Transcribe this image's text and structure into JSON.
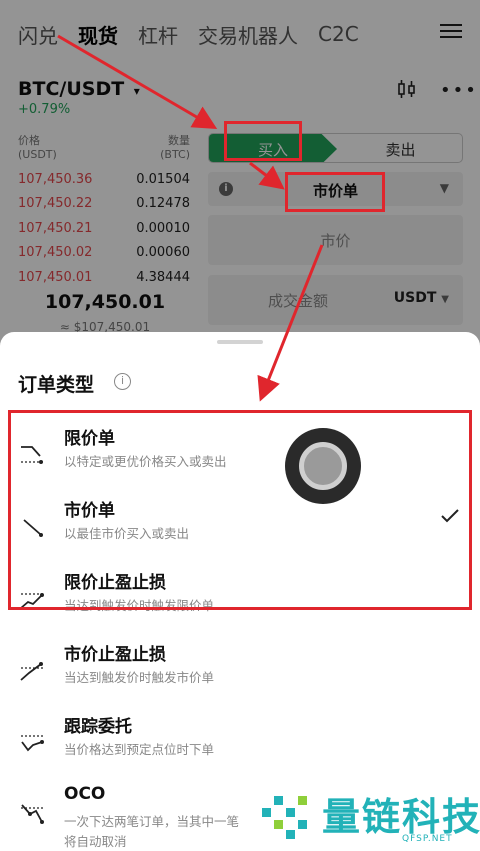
{
  "tabs": [
    "闪兑",
    "现货",
    "杠杆",
    "交易机器人",
    "C2C"
  ],
  "active_tab": "现货",
  "pair": {
    "symbol": "BTC/USDT",
    "change": "+0.79%"
  },
  "orderbook": {
    "price_header": "价格",
    "price_unit": "(USDT)",
    "qty_header": "数量",
    "qty_unit": "(BTC)",
    "asks": [
      {
        "price": "107,450.36",
        "qty": "0.01504"
      },
      {
        "price": "107,450.22",
        "qty": "0.12478"
      },
      {
        "price": "107,450.21",
        "qty": "0.00010"
      },
      {
        "price": "107,450.02",
        "qty": "0.00060"
      },
      {
        "price": "107,450.01",
        "qty": "4.38444"
      }
    ],
    "last_price": "107,450.01",
    "last_price_fiat": "≈ $107,450.01"
  },
  "trade_form": {
    "buy_label": "买入",
    "sell_label": "卖出",
    "order_type": "市价单",
    "price_placeholder": "市价",
    "amount_label": "成交金额",
    "amount_unit": "USDT"
  },
  "sheet": {
    "title": "订单类型",
    "options": [
      {
        "name": "限价单",
        "desc": "以特定或更优价格买入或卖出",
        "selected": false
      },
      {
        "name": "市价单",
        "desc": "以最佳市价买入或卖出",
        "selected": true
      },
      {
        "name": "限价止盈止损",
        "desc": "当达到触发价时触发限价单",
        "selected": false
      },
      {
        "name": "市价止盈止损",
        "desc": "当达到触发价时触发市价单",
        "selected": false
      },
      {
        "name": "跟踪委托",
        "desc": "当价格达到预定点位时下单",
        "selected": false
      },
      {
        "name": "OCO",
        "desc": "一次下达两笔订单，当其中一笔",
        "desc2": "将自动取消",
        "selected": false
      }
    ]
  },
  "watermark": {
    "text": "量链科技",
    "sub": "QFSP.NET"
  },
  "colors": {
    "accent_green": "#21a35a",
    "ask_red": "#e5484d",
    "annotation_red": "#e0262d",
    "watermark": "#22b2b8"
  },
  "icons": [
    "menu-icon",
    "chevron-down-icon",
    "candlestick-icon",
    "more-icon",
    "info-icon",
    "check-icon"
  ]
}
